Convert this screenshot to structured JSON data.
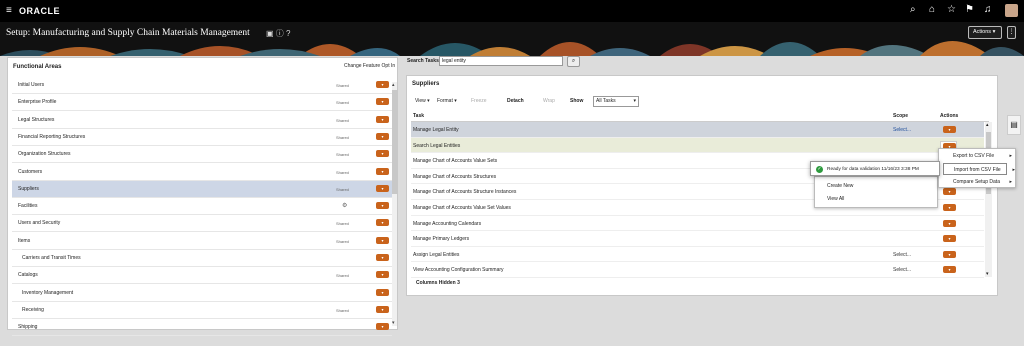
{
  "topbar": {
    "brand": "ORACLE",
    "icons": [
      "hamburger-icon",
      "search-icon",
      "home-icon",
      "star-icon",
      "flag-icon",
      "bell-icon",
      "avatar"
    ]
  },
  "header": {
    "title": "Setup: Manufacturing and Supply Chain Materials Management",
    "actions_label": "Actions ▾",
    "more_label": "⋮"
  },
  "functional_areas": {
    "title": "Functional Areas",
    "change_link": "Change Feature Opt In",
    "items": [
      {
        "label": "Initial Users",
        "status": "Shared",
        "child": false
      },
      {
        "label": "Enterprise Profile",
        "status": "Shared",
        "child": false
      },
      {
        "label": "Legal Structures",
        "status": "Shared",
        "child": false
      },
      {
        "label": "Financial Reporting Structures",
        "status": "Shared",
        "child": false
      },
      {
        "label": "Organization Structures",
        "status": "Shared",
        "child": false
      },
      {
        "label": "Customers",
        "status": "Shared",
        "child": false
      },
      {
        "label": "Suppliers",
        "status": "Shared",
        "child": false,
        "selected": true
      },
      {
        "label": "Facilities",
        "status": "",
        "child": false
      },
      {
        "label": "Users and Security",
        "status": "Shared",
        "child": false
      },
      {
        "label": "Items",
        "status": "Shared",
        "child": false
      },
      {
        "label": "Carriers and Transit Times",
        "status": "",
        "child": true
      },
      {
        "label": "Catalogs",
        "status": "Shared",
        "child": false
      },
      {
        "label": "Inventory Management",
        "status": "",
        "child": true
      },
      {
        "label": "Receiving",
        "status": "Shared",
        "child": true
      },
      {
        "label": "Shipping",
        "status": "",
        "child": false
      }
    ]
  },
  "search": {
    "label": "Search Tasks",
    "value": "legal entity",
    "button_icon": "search-icon"
  },
  "suppliers": {
    "title": "Suppliers",
    "toolbar": {
      "view": "View ▾",
      "format": "Format ▾",
      "freeze": "Freeze",
      "detach": "Detach",
      "wrap": "Wrap",
      "show": "Show",
      "show_value": "All Tasks"
    },
    "columns": {
      "task": "Task",
      "scope": "Scope",
      "actions": "Actions"
    },
    "rows": [
      {
        "task": "Manage Legal Entity",
        "scope": "Select...",
        "selected": true
      },
      {
        "task": "Search Legal Entities",
        "scope": "",
        "highlight": true
      },
      {
        "task": "Manage Chart of Accounts Value Sets",
        "scope": ""
      },
      {
        "task": "Manage Chart of Accounts Structures",
        "scope": ""
      },
      {
        "task": "Manage Chart of Accounts Structure Instances",
        "scope": ""
      },
      {
        "task": "Manage Chart of Accounts Value Set Values",
        "scope": ""
      },
      {
        "task": "Manage Accounting Calendars",
        "scope": ""
      },
      {
        "task": "Manage Primary Ledgers",
        "scope": ""
      },
      {
        "task": "Assign Legal Entities",
        "scope": "Select..."
      },
      {
        "task": "View Accounting Configuration Summary",
        "scope": "Select..."
      }
    ],
    "columns_hidden": "Columns Hidden  3"
  },
  "toast": {
    "message": "Ready for data validation 11/16/23 3:38 PM"
  },
  "context_menu": {
    "items": [
      "Create New",
      "View All"
    ]
  },
  "submenu": {
    "items": [
      {
        "label": "Export to CSV File",
        "arrow": true
      },
      {
        "label": "Import from CSV File",
        "arrow": true,
        "active": true
      },
      {
        "label": "Compare Setup Data",
        "arrow": true
      }
    ]
  },
  "colors": {
    "accent_orange": "#c9631b",
    "selected_row": "#cdd6e6",
    "topbar": "#000000"
  }
}
